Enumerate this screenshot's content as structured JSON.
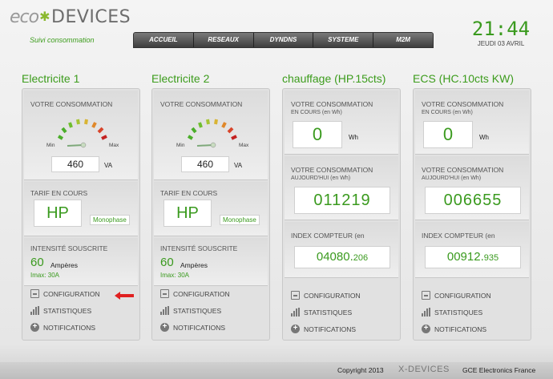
{
  "header": {
    "logo_eco": "eco",
    "logo_devices": "DEVICES",
    "tagline": "Suivi consommation",
    "nav": [
      "ACCUEIL",
      "RESEAUX",
      "DYNDNS",
      "SYSTEME",
      "M2M"
    ],
    "time": "21:44",
    "date": "JEUDI 03 AVRIL"
  },
  "panels": [
    {
      "title": "Electricite 1",
      "consumption_label": "VOTRE CONSOMMATION",
      "gauge_min": "Min",
      "gauge_max": "Max",
      "value": "460",
      "value_unit": "VA",
      "tarif_label": "TARIF EN COURS",
      "tarif": "HP",
      "phase": "Monophase",
      "intensity_label": "INTENSITÉ SOUSCRITE",
      "amps": "60",
      "amps_unit": "Ampères",
      "imax": "Imax: 30A"
    },
    {
      "title": "Electricite 2",
      "consumption_label": "VOTRE CONSOMMATION",
      "gauge_min": "Min",
      "gauge_max": "Max",
      "value": "460",
      "value_unit": "VA",
      "tarif_label": "TARIF EN COURS",
      "tarif": "HP",
      "phase": "Monophase",
      "intensity_label": "INTENSITÉ SOUSCRITE",
      "amps": "60",
      "amps_unit": "Ampères",
      "imax": "Imax: 30A"
    },
    {
      "title": "chauffage (HP.15cts)",
      "consumption_label": "VOTRE CONSOMMATION",
      "consumption_sub": "EN COURS (en Wh)",
      "value": "0",
      "value_unit": "Wh",
      "today_label": "VOTRE CONSOMMATION",
      "today_sub": "AUJOURD'HUI (en Wh)",
      "today_value": "011219",
      "index_label": "INDEX COMPTEUR (en",
      "index_main": "04080.",
      "index_dec": "206"
    },
    {
      "title": "ECS (HC.10cts KW)",
      "consumption_label": "VOTRE CONSOMMATION",
      "consumption_sub": "EN COURS (en Wh)",
      "value": "0",
      "value_unit": "Wh",
      "today_label": "VOTRE CONSOMMATION",
      "today_sub": "AUJOURD'HUI (en Wh)",
      "today_value": "006655",
      "index_label": "INDEX COMPTEUR (en",
      "index_main": "00912.",
      "index_dec": "935"
    }
  ],
  "menu": {
    "config": "CONFIGURATION",
    "stats": "STATISTIQUES",
    "notif": "NOTIFICATIONS"
  },
  "footer": {
    "copyright": "Copyright 2013",
    "brand": "X-DEVICES",
    "company": "GCE Electronics France"
  },
  "colors": {
    "accent_green": "#3a9a1e",
    "arrow_red": "#e02020"
  }
}
